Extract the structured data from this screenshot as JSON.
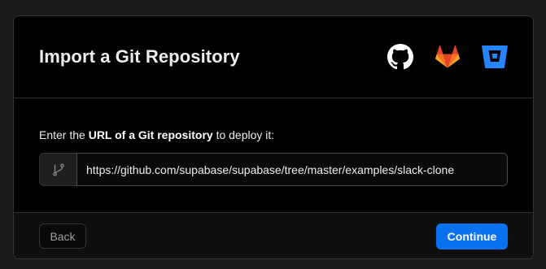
{
  "dialog": {
    "title": "Import a Git Repository",
    "providers": [
      {
        "name": "GitHub",
        "icon": "github-icon"
      },
      {
        "name": "GitLab",
        "icon": "gitlab-icon"
      },
      {
        "name": "Bitbucket",
        "icon": "bitbucket-icon"
      }
    ]
  },
  "form": {
    "prompt_before": "Enter the ",
    "prompt_bold": "URL of a Git repository",
    "prompt_after": " to deploy it:",
    "prefix_icon": "git-branch-icon",
    "url_value": "https://github.com/supabase/supabase/tree/master/examples/slack-clone"
  },
  "footer": {
    "back_label": "Back",
    "continue_label": "Continue"
  },
  "colors": {
    "accent": "#0a72ef",
    "github": "#ffffff",
    "gitlab": "#fc6d26",
    "bitbucket": "#2684ff"
  }
}
